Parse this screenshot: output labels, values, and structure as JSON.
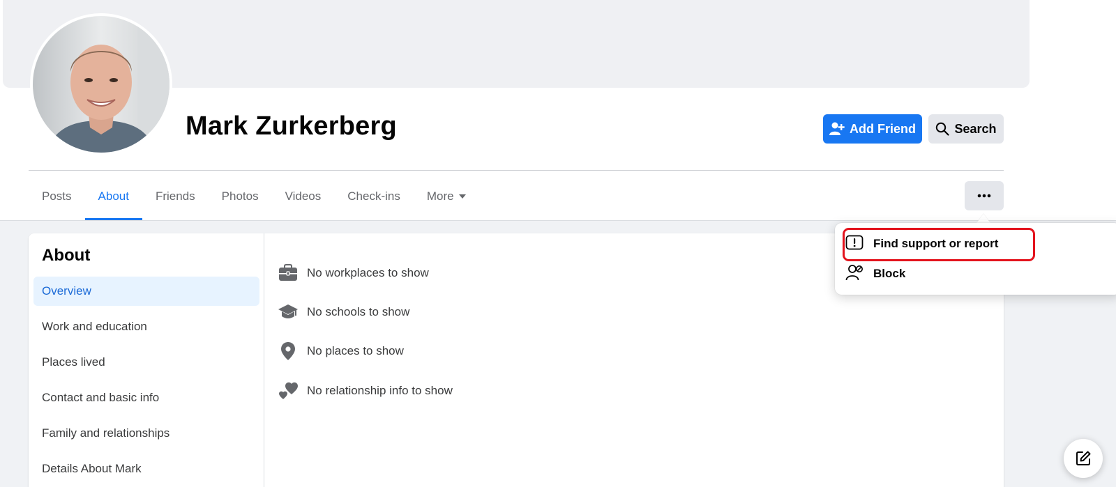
{
  "profile": {
    "name": "Mark Zurkerberg",
    "add_friend_label": "Add Friend",
    "search_label": "Search"
  },
  "tabs": [
    {
      "label": "Posts",
      "active": false
    },
    {
      "label": "About",
      "active": true
    },
    {
      "label": "Friends",
      "active": false
    },
    {
      "label": "Photos",
      "active": false
    },
    {
      "label": "Videos",
      "active": false
    },
    {
      "label": "Check-ins",
      "active": false
    },
    {
      "label": "More",
      "active": false,
      "has_dropdown": true
    }
  ],
  "about": {
    "title": "About",
    "nav": [
      {
        "label": "Overview",
        "active": true
      },
      {
        "label": "Work and education"
      },
      {
        "label": "Places lived"
      },
      {
        "label": "Contact and basic info"
      },
      {
        "label": "Family and relationships"
      },
      {
        "label": "Details About Mark"
      }
    ],
    "info": [
      {
        "icon": "briefcase-icon",
        "text": "No workplaces to show"
      },
      {
        "icon": "graduation-cap-icon",
        "text": "No schools to show"
      },
      {
        "icon": "map-pin-icon",
        "text": "No places to show"
      },
      {
        "icon": "hearts-icon",
        "text": "No relationship info to show"
      }
    ]
  },
  "menu": {
    "items": [
      {
        "label": "Find support or report",
        "icon": "report-icon",
        "highlighted": true
      },
      {
        "label": "Block",
        "icon": "block-user-icon"
      }
    ]
  },
  "colors": {
    "primary": "#1877f2",
    "highlight": "#e3131d",
    "page_bg": "#f0f2f5"
  }
}
